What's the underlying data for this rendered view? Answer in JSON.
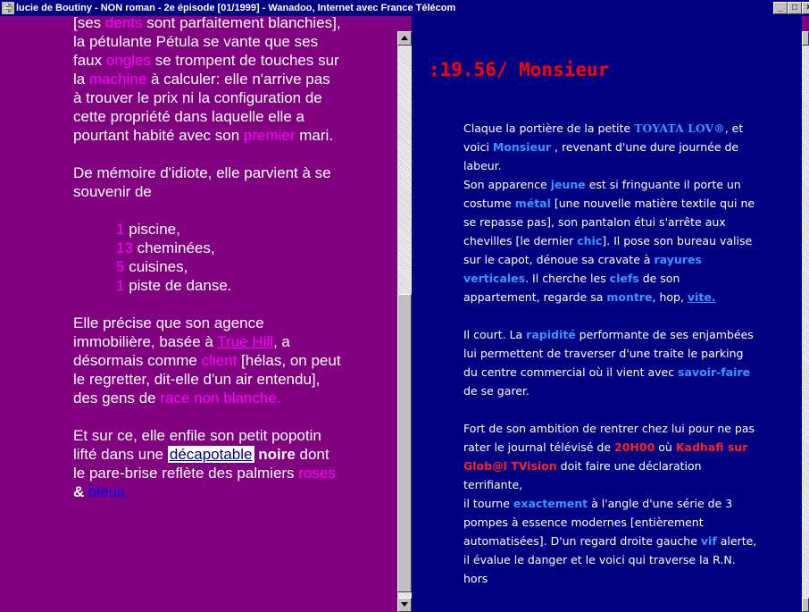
{
  "window": {
    "title": "lucie de Boutiny - NON roman - 2e épisode [01/1999] - Wanadoo, Internet avec France Télécom",
    "min_label": "_",
    "max_label": "□",
    "close_label": "×"
  },
  "left": {
    "p1": {
      "s1": "[ses ",
      "w1": "dents",
      "s2": " sont parfaitement blanchies], la pétulante Pétula se vante que ses faux ",
      "w2": "ongles",
      "s3": " se trompent de touches sur la ",
      "w3": "machine",
      "s4": " à   calculer: elle n'arrive pas à   trouver le prix ni la configuration de cette propriété dans laquelle elle a pourtant habité avec son ",
      "w4": "premier",
      "s5": " mari."
    },
    "p2": "De mémoire d'idiote, elle parvient à   se souvenir de",
    "list": [
      {
        "num": "1",
        "text": " piscine,"
      },
      {
        "num": "13",
        "text": " cheminées,"
      },
      {
        "num": "5",
        "text": " cuisines,"
      },
      {
        "num": "1",
        "text": " piste de danse."
      }
    ],
    "p3": {
      "s1": "Elle précise que son agence immobilière, basée à  ",
      "w1": "True Hill",
      "s2": ", a désormais comme ",
      "w2": "client",
      "s3": " [hélas, on peut le regretter, dit-elle d'un air entendu], des gens de ",
      "w3": "race non blanche."
    },
    "p4": {
      "s1": "Et sur ce, elle enfile son petit popotin lifté dans une ",
      "w1": "décapotable",
      "s2": "  ",
      "w2": "noire",
      "s3": " dont le pare-brise reflète des palmiers ",
      "w3": "roses",
      "s4": " & ",
      "w4": "bleus."
    }
  },
  "right": {
    "title": ":19.56/ Monsieur",
    "p1": {
      "s1": "Claque la portière de la petite ",
      "brand": "TOYATA LOV®",
      "s2": ", et voici ",
      "w1": "Monsieur",
      "s3": " , revenant d'une dure journée de labeur.",
      "s4": "Son apparence ",
      "w2": "jeune",
      "s5": " est si fringuante il porte un costume ",
      "w3": "métal",
      "s6": " [une nouvelle matière textile qui ne se repasse pas], son pantalon étui s'arrête aux chevilles [le dernier ",
      "w4": "chic",
      "s7": "]. Il pose son bureau valise sur le capot, dénoue sa cravate à ",
      "w5": "rayures verticales",
      "s8": ". Il cherche les ",
      "w6": "clefs",
      "s9": " de son appartement, regarde sa ",
      "w7": "montre",
      "s10": ", hop, ",
      "w8": "vite."
    },
    "p2": {
      "s1": "Il court. La ",
      "w1": "rapidité",
      "s2": " performante de ses enjambées lui permettent de traverser d'une traite le parking du centre commercial où il vient avec ",
      "w2": "savoir-faire",
      "s3": " de se garer."
    },
    "p3": {
      "s1": "Fort de son ambition de rentrer chez lui pour ne pas rater le journal télévisé de ",
      "w1": "20H00",
      "s2": " où ",
      "w2": "Kadhafi sur Glob@l TVision",
      "s3": " doit faire une déclaration terrifiante,",
      "s4": "il tourne ",
      "w3": "exactement",
      "s5": " à l'angle d'une série de 3 pompes à essence modernes [entièrement automatisées]. D'un regard droite gauche ",
      "w4": "vif",
      "s6": " alerte, il évalue le danger et le voici qui traverse la R.N. hors"
    }
  }
}
